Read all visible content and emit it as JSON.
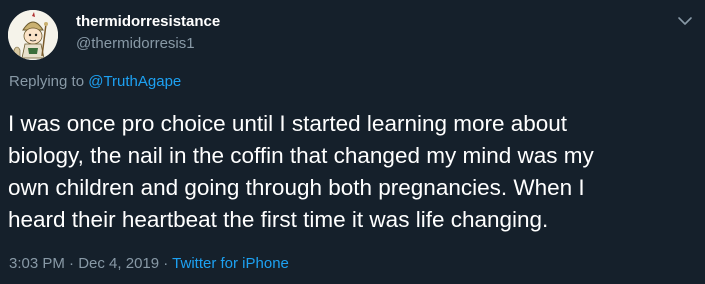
{
  "user": {
    "display_name": "thermidorresistance",
    "handle": "@thermidorresis1",
    "avatar_icon": "cartoon-character-avatar"
  },
  "reply": {
    "prefix": "Replying to ",
    "mention": "@TruthAgape"
  },
  "tweet": {
    "lines": [
      "I was once pro choice until I started learning more about",
      "biology, the nail in the coffin that changed my mind was my",
      "own children and going through both pregnancies.  When I",
      "heard their heartbeat the first time it was life changing."
    ]
  },
  "meta": {
    "time": "3:03 PM",
    "separator1": " · ",
    "date": "Dec 4, 2019",
    "separator2": " · ",
    "source": "Twitter for iPhone"
  },
  "colors": {
    "background": "#15202b",
    "text": "#ffffff",
    "secondary": "#8899a6",
    "link": "#1da1f2"
  },
  "icons": {
    "menu": "chevron-down-icon"
  }
}
